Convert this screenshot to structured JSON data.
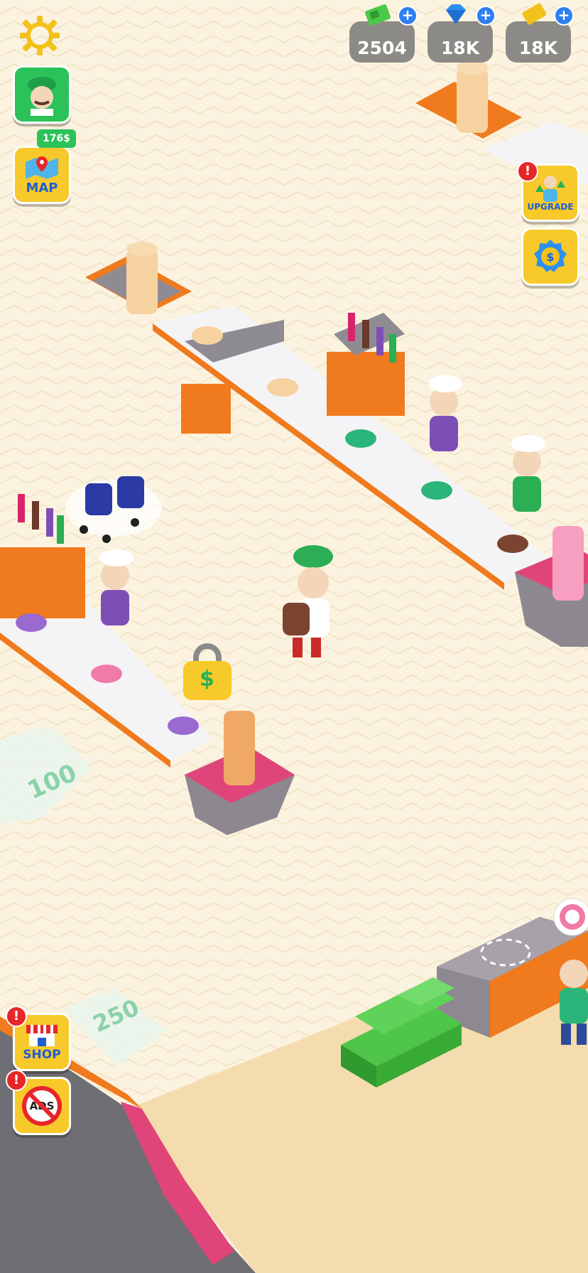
{
  "hud": {
    "currencies": [
      {
        "name": "cash",
        "value": "2504",
        "color": "#4ac84a"
      },
      {
        "name": "gems",
        "value": "18K",
        "color": "#2f8ff0"
      },
      {
        "name": "tickets",
        "value": "18K",
        "color": "#f2c21a"
      }
    ],
    "map_label": "MAP",
    "map_badge": "176$",
    "upgrade_label": "UPGRADE",
    "shop_label": "SHOP",
    "ads_label": "ADS",
    "alert_mark": "!"
  },
  "floor": {
    "unlock_cost_1": "100",
    "unlock_cost_2": "250",
    "lock_symbol": "$"
  },
  "colors": {
    "floor": "#fbf3df",
    "conveyor_orange": "#f07a1e",
    "counter_pink": "#e0457a",
    "accent_yellow": "#f7c92a",
    "hud_gray": "#8c8a86"
  }
}
